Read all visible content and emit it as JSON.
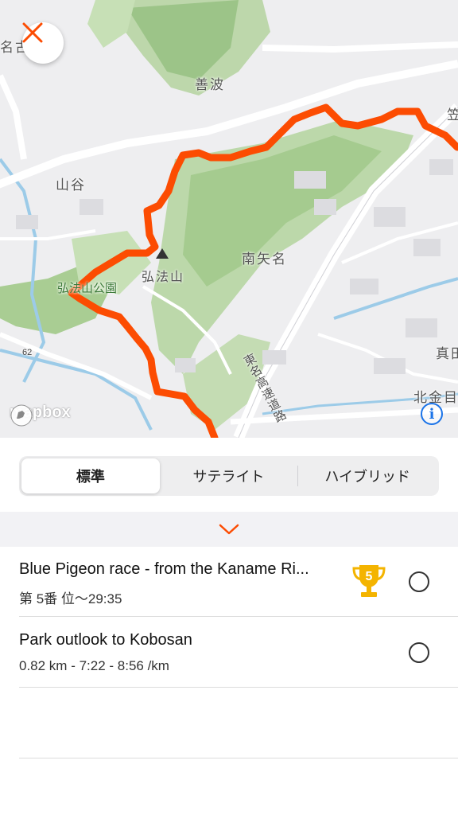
{
  "map": {
    "labels": {
      "nagoya_partial": "名古",
      "zenba": "善波",
      "yamaya": "山谷",
      "minamiyana": "南矢名",
      "kobosan": "弘法山",
      "kobosan_park": "弘法山公園",
      "kasa_partial": "笠",
      "mada_partial": "真田",
      "kitakane_partial": "北金目",
      "tomei": "東名高速道路",
      "route62": "62"
    },
    "attribution": "mapbox",
    "route_color": "#fc4c02"
  },
  "controls": {
    "close_icon": "close-x-icon",
    "info_icon": "info-icon"
  },
  "map_type": {
    "options": [
      "標準",
      "サテライト",
      "ハイブリッド"
    ],
    "selected": "標準"
  },
  "segments": [
    {
      "title": "Blue Pigeon race - from the Kaname Ri...",
      "subtitle": "第 5番 位〜29:35",
      "trophy_rank": "5",
      "selected": false
    },
    {
      "title": "Park outlook to Kobosan",
      "subtitle": "0.82 km - 7:22 - 8:56 /km",
      "selected": false
    }
  ],
  "accent": "#fc4c02"
}
